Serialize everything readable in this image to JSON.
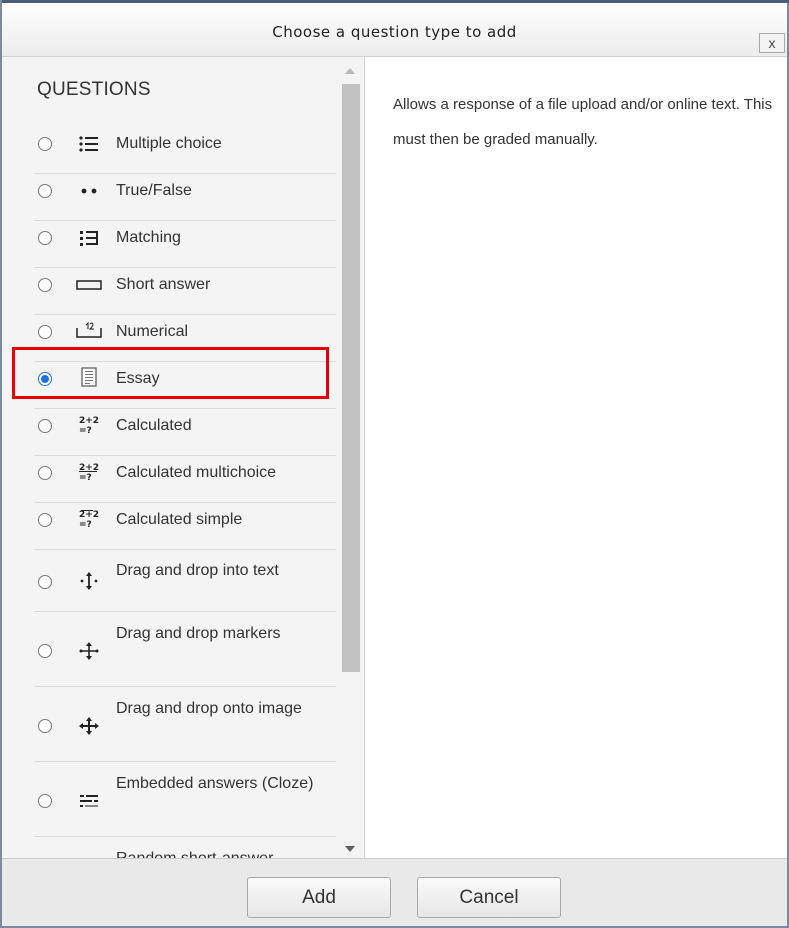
{
  "dialog": {
    "title": "Choose a question type to add",
    "close_label": "x"
  },
  "questions": {
    "heading": "QUESTIONS",
    "items": [
      {
        "label": "Multiple choice",
        "icon": "multiple-choice-icon",
        "checked": false
      },
      {
        "label": "True/False",
        "icon": "true-false-icon",
        "checked": false
      },
      {
        "label": "Matching",
        "icon": "matching-icon",
        "checked": false
      },
      {
        "label": "Short answer",
        "icon": "short-answer-icon",
        "checked": false
      },
      {
        "label": "Numerical",
        "icon": "numerical-icon",
        "checked": false
      },
      {
        "label": "Essay",
        "icon": "essay-icon",
        "checked": true
      },
      {
        "label": "Calculated",
        "icon": "calculated-icon",
        "checked": false
      },
      {
        "label": "Calculated multichoice",
        "icon": "calculated-multichoice-icon",
        "checked": false
      },
      {
        "label": "Calculated simple",
        "icon": "calculated-simple-icon",
        "checked": false
      },
      {
        "label": "Drag and drop into text",
        "icon": "drag-drop-text-icon",
        "checked": false
      },
      {
        "label": "Drag and drop markers",
        "icon": "drag-drop-markers-icon",
        "checked": false
      },
      {
        "label": "Drag and drop onto image",
        "icon": "drag-drop-image-icon",
        "checked": false
      },
      {
        "label": "Embedded answers (Cloze)",
        "icon": "cloze-icon",
        "checked": false
      },
      {
        "label": "Random short-answer matching",
        "icon": "random-matching-icon",
        "checked": false
      }
    ]
  },
  "description": "Allows a response of a file upload and/or online text. This must then be graded manually.",
  "footer": {
    "add_label": "Add",
    "cancel_label": "Cancel"
  },
  "colors": {
    "selection": "#1a73e8",
    "highlight_box": "#e60000"
  }
}
